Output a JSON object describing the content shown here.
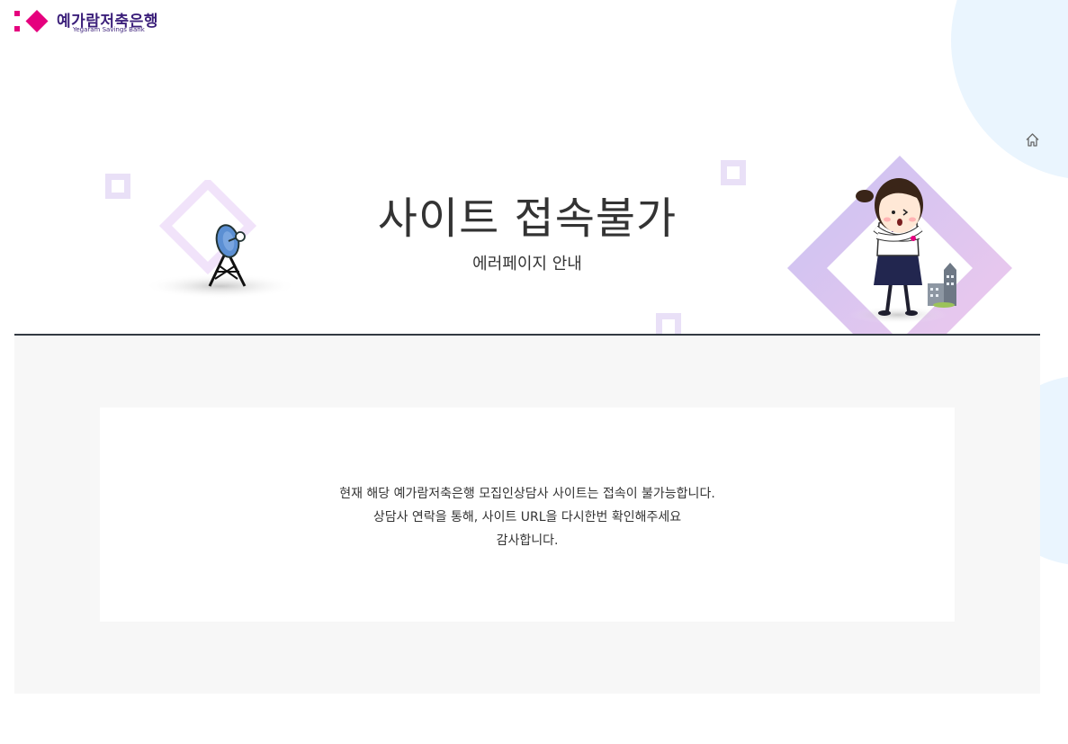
{
  "brand": {
    "name": "예가람저축은행",
    "sub": "Yegaram Savings Bank",
    "colors": {
      "pink": "#e5007e",
      "purple": "#3b1f7a"
    }
  },
  "nav": {
    "home_icon": "home-icon"
  },
  "hero": {
    "title": "사이트 접속불가",
    "subtitle": "에러페이지 안내"
  },
  "message": {
    "line1": "현재 해당 예가람저축은행 모집인상담사 사이트는 접속이 불가능합니다.",
    "line2": "상담사 연락을 통해, 사이트 URL을 다시한번 확인해주세요",
    "line3": "감사합니다."
  }
}
